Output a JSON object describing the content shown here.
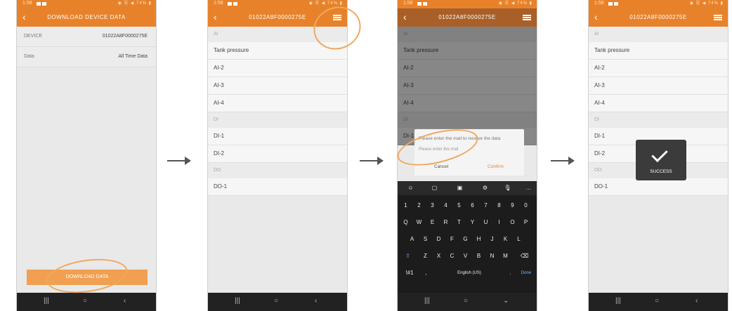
{
  "phone1": {
    "time": "1:58",
    "status_right": "◉ ☰ ◀ 74% ▮",
    "title": "DOWNLOAD DEVICE DATA",
    "fields": [
      {
        "label": "DEVICE",
        "value": "01022A8F0000275E"
      },
      {
        "label": "Data",
        "value": "All Time Data"
      }
    ],
    "download_button": "DOWNLOAD DATA"
  },
  "phone2": {
    "time": "1:58",
    "status_right": "◉ ☰ ◀ 74% ▮",
    "title": "01022A8F0000275E",
    "rows": [
      {
        "kind": "hdr",
        "text": "AI"
      },
      {
        "kind": "row",
        "text": "Tank pressure"
      },
      {
        "kind": "row",
        "text": "AI-2"
      },
      {
        "kind": "row",
        "text": "AI-3"
      },
      {
        "kind": "row",
        "text": "AI-4"
      },
      {
        "kind": "hdr",
        "text": "DI"
      },
      {
        "kind": "row",
        "text": "DI-1"
      },
      {
        "kind": "row",
        "text": "DI-2"
      },
      {
        "kind": "hdr",
        "text": "DO"
      },
      {
        "kind": "row",
        "text": "DO-1"
      }
    ]
  },
  "phone3": {
    "time": "1:58",
    "status_right": "◉ ☰ ◀ 74% ▮",
    "title": "01022A8F0000275E",
    "rows": [
      {
        "kind": "hdr",
        "text": "AI"
      },
      {
        "kind": "row",
        "text": "Tank pressure"
      },
      {
        "kind": "row",
        "text": "AI-2"
      },
      {
        "kind": "row",
        "text": "AI-3"
      },
      {
        "kind": "row",
        "text": "AI-4"
      },
      {
        "kind": "hdr",
        "text": "DI"
      },
      {
        "kind": "row",
        "text": "DI-1"
      }
    ],
    "dialog": {
      "message": "Please enter the mail to receive the data",
      "placeholder": "Please enter the mail",
      "cancel": "Cancel",
      "confirm": "Confirm"
    },
    "keyboard": {
      "numbers": [
        "1",
        "2",
        "3",
        "4",
        "5",
        "6",
        "7",
        "8",
        "9",
        "0"
      ],
      "row1": [
        "Q",
        "W",
        "E",
        "R",
        "T",
        "Y",
        "U",
        "I",
        "O",
        "P"
      ],
      "row2": [
        "A",
        "S",
        "D",
        "F",
        "G",
        "H",
        "J",
        "K",
        "L"
      ],
      "row3": [
        "Z",
        "X",
        "C",
        "V",
        "B",
        "N",
        "M"
      ],
      "sym": "!#1",
      "comma": ",",
      "space": "English (US)",
      "period": ".",
      "done": "Done"
    }
  },
  "phone4": {
    "time": "1:58",
    "status_right": "◉ ☰ ◀ 74% ▮",
    "title": "01022A8F0000275E",
    "rows": [
      {
        "kind": "hdr",
        "text": "AI"
      },
      {
        "kind": "row",
        "text": "Tank pressure"
      },
      {
        "kind": "row",
        "text": "AI-2"
      },
      {
        "kind": "row",
        "text": "AI-3"
      },
      {
        "kind": "row",
        "text": "AI-4"
      },
      {
        "kind": "hdr",
        "text": "DI"
      },
      {
        "kind": "row",
        "text": "DI-1"
      },
      {
        "kind": "row",
        "text": "DI-2"
      },
      {
        "kind": "hdr",
        "text": "DO"
      },
      {
        "kind": "row",
        "text": "DO-1"
      }
    ],
    "toast": "SUCCESS"
  },
  "colors": {
    "accent": "#e8822a",
    "highlight_circle": "#f0a85c",
    "navbar": "#222222"
  }
}
